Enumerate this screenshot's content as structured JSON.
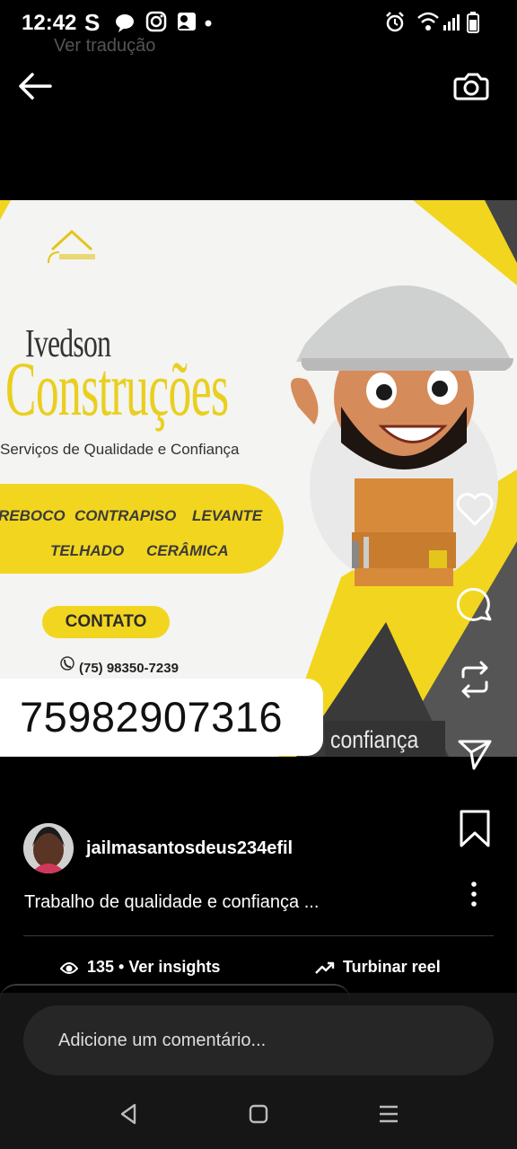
{
  "status_bar": {
    "time": "12:42"
  },
  "overlay": {
    "translate_label": "Ver tradução"
  },
  "poster": {
    "brand_line1": "Ivedson",
    "brand_line2": "Construções",
    "tagline": "Serviços de Qualidade e Confiança",
    "services": [
      "REBOCO",
      "CONTRAPISO",
      "LEVANTE",
      "TELHADO",
      "CERÂMICA"
    ],
    "contact_button": "CONTATO",
    "contact_phone": "(75) 98350-7239",
    "big_phone": "75982907316",
    "overlay_text": "confiança"
  },
  "post": {
    "username": "jailmasantosdeus234efil",
    "caption": "Trabalho de qualidade e confiança ...",
    "views": "135 • Ver insights",
    "boost_label": "Turbinar reel"
  },
  "comment": {
    "placeholder": "Adicione um comentário..."
  },
  "icons": [
    "back-arrow-icon",
    "camera-icon",
    "heart-icon",
    "comment-icon",
    "repost-icon",
    "send-icon",
    "bookmark-icon",
    "more-icon",
    "eye-icon",
    "trending-up-icon"
  ],
  "colors": {
    "accent_yellow": "#f2d51f",
    "background": "#000000"
  }
}
